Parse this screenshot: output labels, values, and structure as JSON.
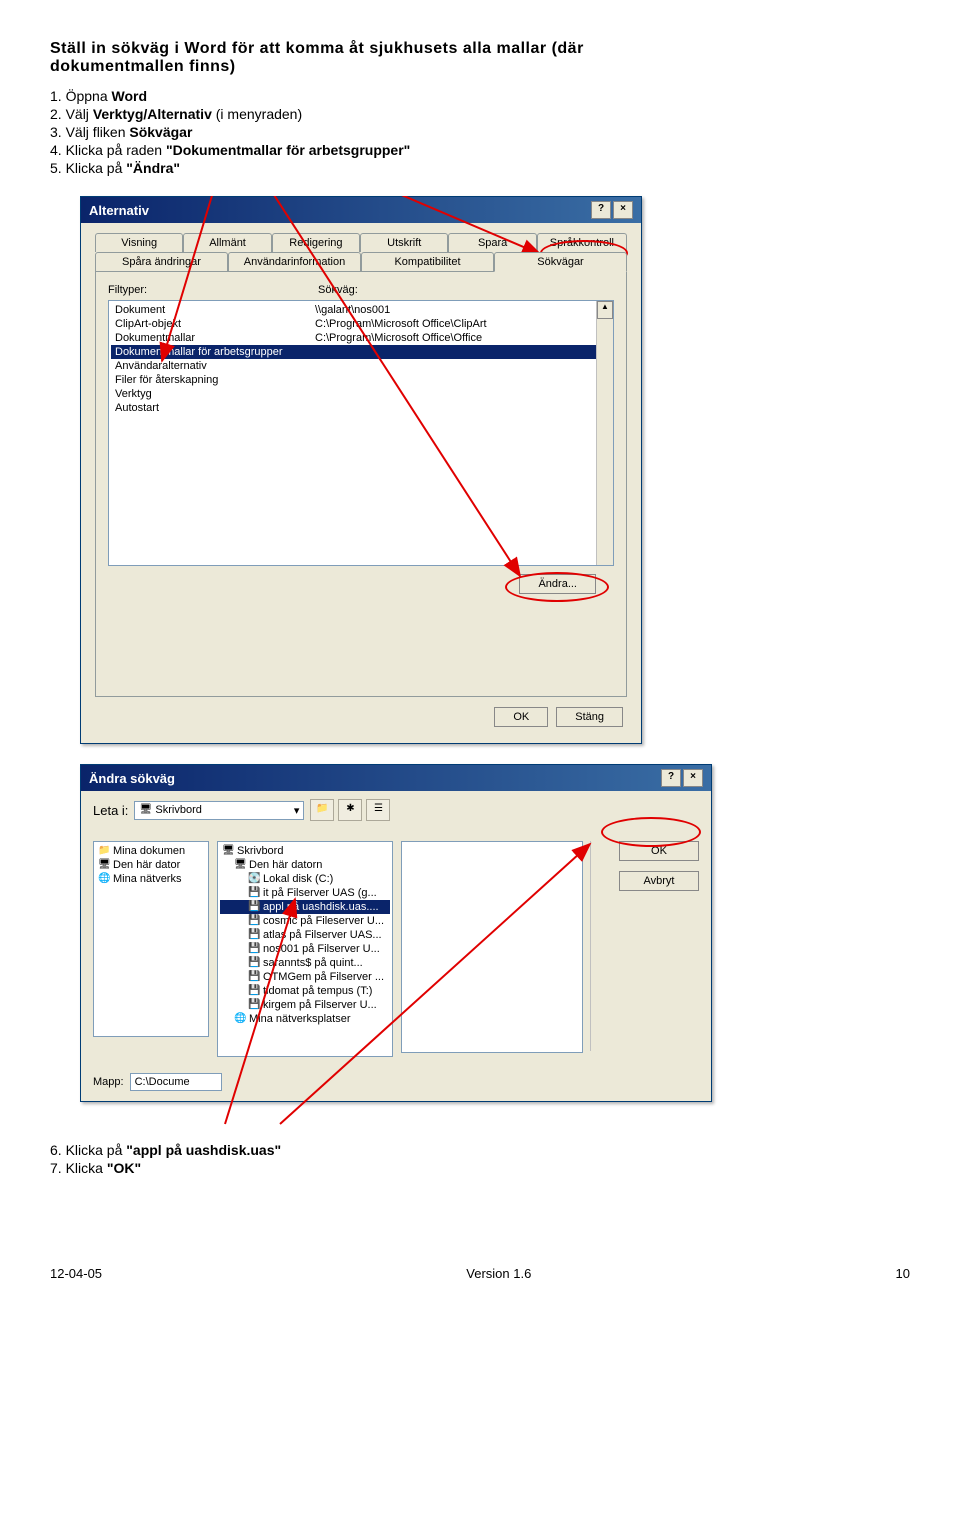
{
  "page_title_a": "Ställ in sökväg i Word för att komma åt sjukhusets alla mallar (där",
  "page_title_b": "dokumentmallen finns)",
  "steps": {
    "s1a": "1. Öppna ",
    "s1b": "Word",
    "s2a": "2. Välj ",
    "s2b": "Verktyg/Alternativ",
    "s2c": " (i menyraden)",
    "s3a": "3. Välj fliken ",
    "s3b": "Sökvägar",
    "s4a": "4. Klicka på raden ",
    "s4b": "\"Dokumentmallar för arbetsgrupper\"",
    "s5a": "5. Klicka på ",
    "s5b": "\"Ändra\""
  },
  "dialog1": {
    "title": "Alternativ",
    "tabs_row1": [
      "Visning",
      "Allmänt",
      "Redigering",
      "Utskrift",
      "Spara",
      "Språkkontroll"
    ],
    "tabs_row2": [
      "Spåra ändringar",
      "Användarinformation",
      "Kompatibilitet",
      "Sökvägar"
    ],
    "col1": "Filtyper:",
    "col2": "Sökväg:",
    "rows": [
      {
        "t": "Dokument",
        "p": "\\\\galant\\nos001"
      },
      {
        "t": "ClipArt-objekt",
        "p": "C:\\Program\\Microsoft Office\\ClipArt"
      },
      {
        "t": "Dokumentmallar",
        "p": "C:\\Program\\Microsoft Office\\Office"
      },
      {
        "t": "Dokumentmallar för arbetsgrupper",
        "p": ""
      },
      {
        "t": "Användaralternativ",
        "p": ""
      },
      {
        "t": "Filer för återskapning",
        "p": ""
      },
      {
        "t": "Verktyg",
        "p": ""
      },
      {
        "t": "Autostart",
        "p": ""
      }
    ],
    "andra": "Ändra...",
    "ok": "OK",
    "stang": "Stäng"
  },
  "dialog2": {
    "title": "Ändra sökväg",
    "leta": "Leta i:",
    "dd1": "Skrivbord",
    "left": [
      "Mina dokumen",
      "Den här dator",
      "Mina nätverks"
    ],
    "mid": [
      "Skrivbord",
      "Den här datorn",
      "Lokal disk (C:)",
      "it på Filserver UAS (g...",
      "appl på uashdisk.uas....",
      "cosmic på Fileserver U...",
      "atlas på Filserver UAS...",
      "nos001 på Filserver U...",
      "sarannts$ på quint...",
      "OTMGem på Filserver ...",
      "tidomat på tempus (T:)",
      "kirgem på Filserver U...",
      "Mina nätverksplatser"
    ],
    "ok": "OK",
    "avbryt": "Avbryt",
    "mapp": "Mapp:",
    "mapp_val": "C:\\Docume"
  },
  "post_steps": {
    "s6a": "6. Klicka på ",
    "s6b": "\"appl på uashdisk.uas\"",
    "s7a": "7. Klicka ",
    "s7b": "\"OK\""
  },
  "footer": {
    "left": "12-04-05",
    "mid": "Version 1.6",
    "right": "10"
  }
}
